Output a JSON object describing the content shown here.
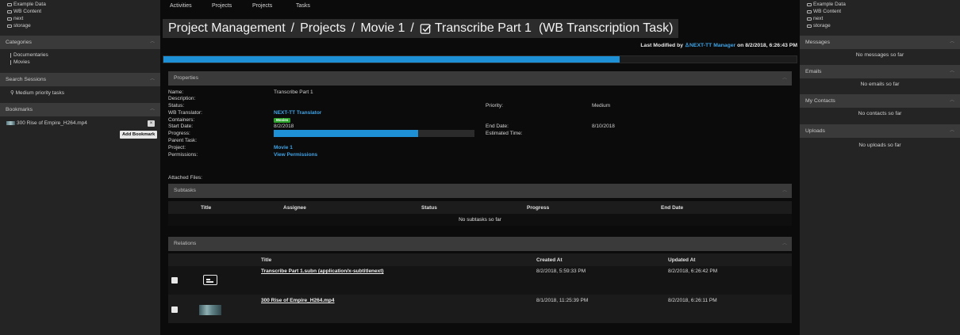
{
  "left": {
    "tree": [
      "Example Data",
      "WB Content",
      "next",
      "storage"
    ],
    "categories_title": "Categories",
    "categories": [
      "Documentaries",
      "Movies"
    ],
    "search_title": "Search Sessions",
    "search_items": [
      "Medium priority tasks"
    ],
    "bookmarks_title": "Bookmarks",
    "bookmark": "300 Rise of Empire_H264.mp4",
    "bookmark_close": "×",
    "add_bookmark": "Add Bookmark"
  },
  "right": {
    "tree": [
      "Example Data",
      "WB Content",
      "next",
      "storage"
    ],
    "messages_title": "Messages",
    "messages_empty": "No messages so far",
    "emails_title": "Emails",
    "emails_empty": "No emails so far",
    "contacts_title": "My Contacts",
    "contacts_empty": "No contacts so far",
    "uploads_title": "Uploads",
    "uploads_empty": "No uploads so far"
  },
  "nav": [
    "Activities",
    "Projects",
    "Projects",
    "Tasks"
  ],
  "breadcrumb": {
    "parts": [
      "Project Management",
      "Projects",
      "Movie 1"
    ],
    "sep": "/",
    "task": "Transcribe Part 1",
    "type": "(WB Transcription Task)"
  },
  "last_modified": {
    "prefix": "Last Modified by",
    "user": "NEXT-TT Manager",
    "suffix": "on 8/2/2018, 6:26:43 PM"
  },
  "top_progress": 0.72,
  "properties": {
    "title": "Properties",
    "labels": {
      "name": "Name:",
      "description": "Description:",
      "status": "Status:",
      "translator": "WB Translator:",
      "containers": "Containers:",
      "start": "Start Date:",
      "progress": "Progress:",
      "parent": "Parent Task:",
      "project": "Project:",
      "permissions": "Permissions:",
      "priority": "Priority:",
      "end": "End Date:",
      "estimated": "Estimated Time:"
    },
    "values": {
      "name": "Transcribe Part 1",
      "translator": "NEXT-TT Translator",
      "container_badge": "Movies",
      "start": "8/2/2018",
      "project": "Movie 1",
      "permissions": "View Permissions",
      "priority": "Medium",
      "end": "8/10/2018"
    },
    "progress": 0.72
  },
  "attached_files": "Attached Files:",
  "subtasks": {
    "title": "Subtasks",
    "columns": [
      "Title",
      "Assignee",
      "Status",
      "Progress",
      "End Date"
    ],
    "empty": "No subtasks so far"
  },
  "relations": {
    "title": "Relations",
    "columns": [
      "Title",
      "Created At",
      "Updated At"
    ],
    "rows": [
      {
        "title": "Transcribe Part 1.subn (application/x-subtitlenext)",
        "created": "8/2/2018, 5:59:33 PM",
        "updated": "8/2/2018, 6:26:42 PM",
        "icon": "subtitle-file-icon"
      },
      {
        "title": "300 Rise of Empire_H264.mp4",
        "created": "8/1/2018, 11:25:39 PM",
        "updated": "8/2/2018, 6:26:11 PM",
        "icon": "video-thumbnail"
      }
    ]
  }
}
